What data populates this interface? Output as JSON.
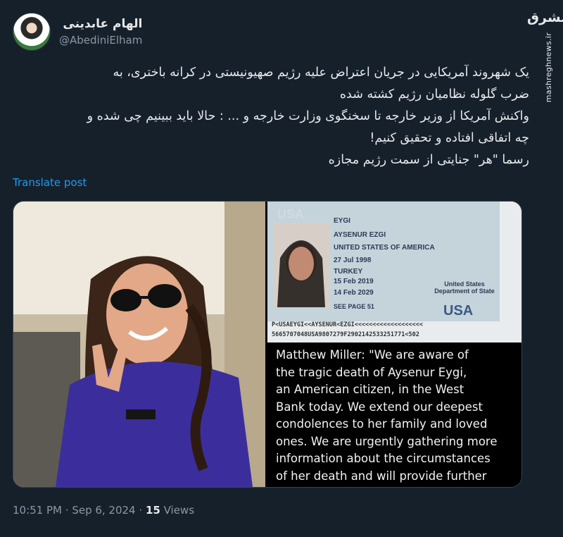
{
  "watermark": {
    "logo": "مشرق",
    "url": "mashreghnews.ir"
  },
  "author": {
    "display_name": "الهام عابدینی",
    "handle": "@AbediniElham"
  },
  "tweet": {
    "lines": [
      "یک شهروند آمریکایی در جریان اعتراض علیه رژیم صهیونیستی در کرانه باختری، به",
      "ضرب گلوله نظامیان رژیم کشته شده",
      "واکنش آمریکا از وزیر خارجه تا سخنگوی وزارت خارجه و ... : حالا باید ببینیم چی شده و",
      "چه اتفاقی افتاده و تحقیق کنیم!",
      "رسما \"هر\" جنایتی از سمت رژیم مجازه"
    ],
    "translate_label": "Translate post"
  },
  "passport": {
    "header": "USA",
    "surname": "EYGI",
    "given_names": "AYSENUR EZGI",
    "nationality": "UNITED STATES OF AMERICA",
    "birth_date": "27 Jul 1998",
    "birth_place": "TURKEY",
    "issue_date": "15 Feb 2019",
    "expiry_date": "14 Feb 2029",
    "authority": "United States Department of State",
    "endorsement": "SEE PAGE 51",
    "footer_mark": "USA",
    "mrz1": "P<USAEYGI<<AYSENUR<EZGI<<<<<<<<<<<<<<<<<<<",
    "mrz2": "5665707048USA9807279F2902142533251771<502"
  },
  "quote": {
    "lines": [
      "Matthew Miller: \"We are aware of",
      "the tragic death of Aysenur Eygi,",
      "an American citizen, in the West",
      "Bank today. We extend our deepest",
      "condolences to her family and loved",
      "ones. We are urgently gathering more",
      "information about the circumstances",
      "of her death and will provide further"
    ]
  },
  "footer": {
    "time": "10:51 PM",
    "date": "Sep 6, 2024",
    "views_count": "15",
    "views_label": "Views"
  }
}
